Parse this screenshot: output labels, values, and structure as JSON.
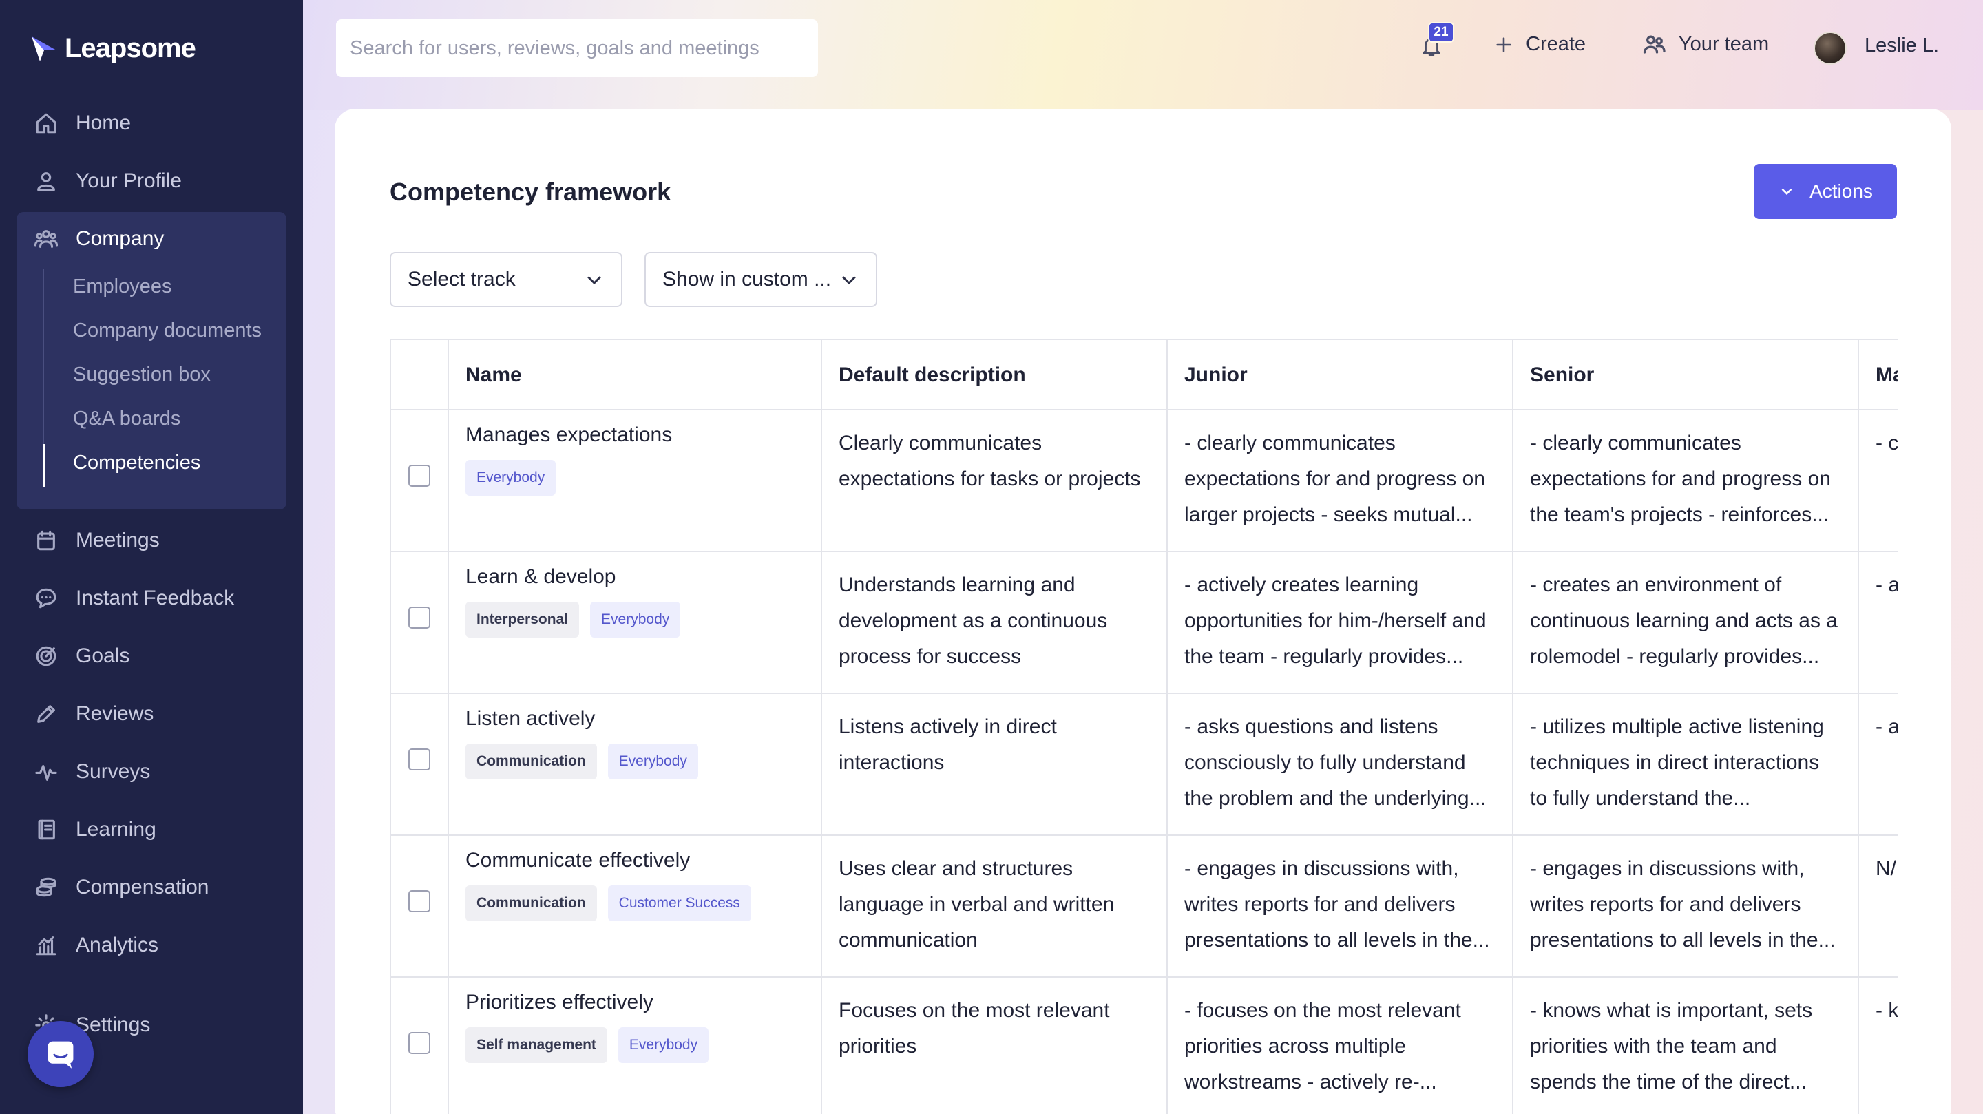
{
  "brand": {
    "name": "Leapsome"
  },
  "sidebar": {
    "items": [
      {
        "label": "Home",
        "icon": "home-icon"
      },
      {
        "label": "Your Profile",
        "icon": "user-icon"
      },
      {
        "label": "Company",
        "icon": "users-icon"
      },
      {
        "label": "Meetings",
        "icon": "calendar-icon"
      },
      {
        "label": "Instant Feedback",
        "icon": "chat-icon"
      },
      {
        "label": "Goals",
        "icon": "target-icon"
      },
      {
        "label": "Reviews",
        "icon": "pencil-icon"
      },
      {
        "label": "Surveys",
        "icon": "pulse-icon"
      },
      {
        "label": "Learning",
        "icon": "book-icon"
      },
      {
        "label": "Compensation",
        "icon": "coins-icon"
      },
      {
        "label": "Analytics",
        "icon": "bar-chart-icon"
      },
      {
        "label": "Settings",
        "icon": "gear-icon"
      }
    ],
    "company_sub": [
      "Employees",
      "Company documents",
      "Suggestion box",
      "Q&A boards",
      "Competencies"
    ],
    "active_sub": "Competencies"
  },
  "topbar": {
    "search_placeholder": "Search for users, reviews, goals and meetings",
    "notifications_count": "21",
    "create_label": "Create",
    "team_label": "Your team",
    "user_label": "Leslie L."
  },
  "page": {
    "title": "Competency framework",
    "actions_label": "Actions",
    "select_track": "Select track",
    "show_custom": "Show in custom ..."
  },
  "table": {
    "headers": [
      "Name",
      "Default description",
      "Junior",
      "Senior",
      "Ma"
    ],
    "rows": [
      {
        "name": "Manages expectations",
        "tags": [
          {
            "label": "Everybody",
            "style": "purple"
          }
        ],
        "default": "Clearly communicates expectations for tasks or projects",
        "junior": "- clearly communicates expectations for and progress on larger projects - seeks mutual...",
        "senior": "- clearly communicates expectations for and progress on the team's projects - reinforces...",
        "manager": "- c ex tas"
      },
      {
        "name": "Learn & develop",
        "tags": [
          {
            "label": "Interpersonal",
            "style": "grey"
          },
          {
            "label": "Everybody",
            "style": "purple"
          }
        ],
        "default": "Understands learning and development as a continuous process for success",
        "junior": "- actively creates learning opportunities for him-/herself and the team - regularly provides...",
        "senior": "- creates an environment of continuous learning and acts as a rolemodel - regularly provides...",
        "manager": "- a op gr"
      },
      {
        "name": "Listen actively",
        "tags": [
          {
            "label": "Communication",
            "style": "grey"
          },
          {
            "label": "Everybody",
            "style": "purple"
          }
        ],
        "default": "Listens actively in direct interactions",
        "junior": "- asks questions and listens consciously to fully understand the problem and the underlying...",
        "senior": "- utilizes multiple active listening techniques in direct interactions to fully understand the...",
        "manager": "- a co th"
      },
      {
        "name": "Communicate effectively",
        "tags": [
          {
            "label": "Communication",
            "style": "grey"
          },
          {
            "label": "Customer Success",
            "style": "purple"
          }
        ],
        "default": "Uses clear and structures language in verbal and written communication",
        "junior": "- engages in discussions with, writes reports for and delivers presentations to all levels in the...",
        "senior": "- engages in discussions with, writes reports for and delivers presentations to all levels in the...",
        "manager": "N/"
      },
      {
        "name": "Prioritizes effectively",
        "tags": [
          {
            "label": "Self management",
            "style": "grey"
          },
          {
            "label": "Everybody",
            "style": "purple"
          }
        ],
        "default": "Focuses on the most relevant priorities",
        "junior": "- focuses on the most relevant priorities across multiple workstreams - actively re-...",
        "senior": "- knows what is important, sets priorities with the team and spends the time of the direct...",
        "manager": "- k ca his"
      }
    ]
  },
  "colors": {
    "sidebar": "#1f2347",
    "sidebar_active": "#2d3261",
    "accent": "#5a5ce8",
    "tag_purple_text": "#5457cc"
  }
}
